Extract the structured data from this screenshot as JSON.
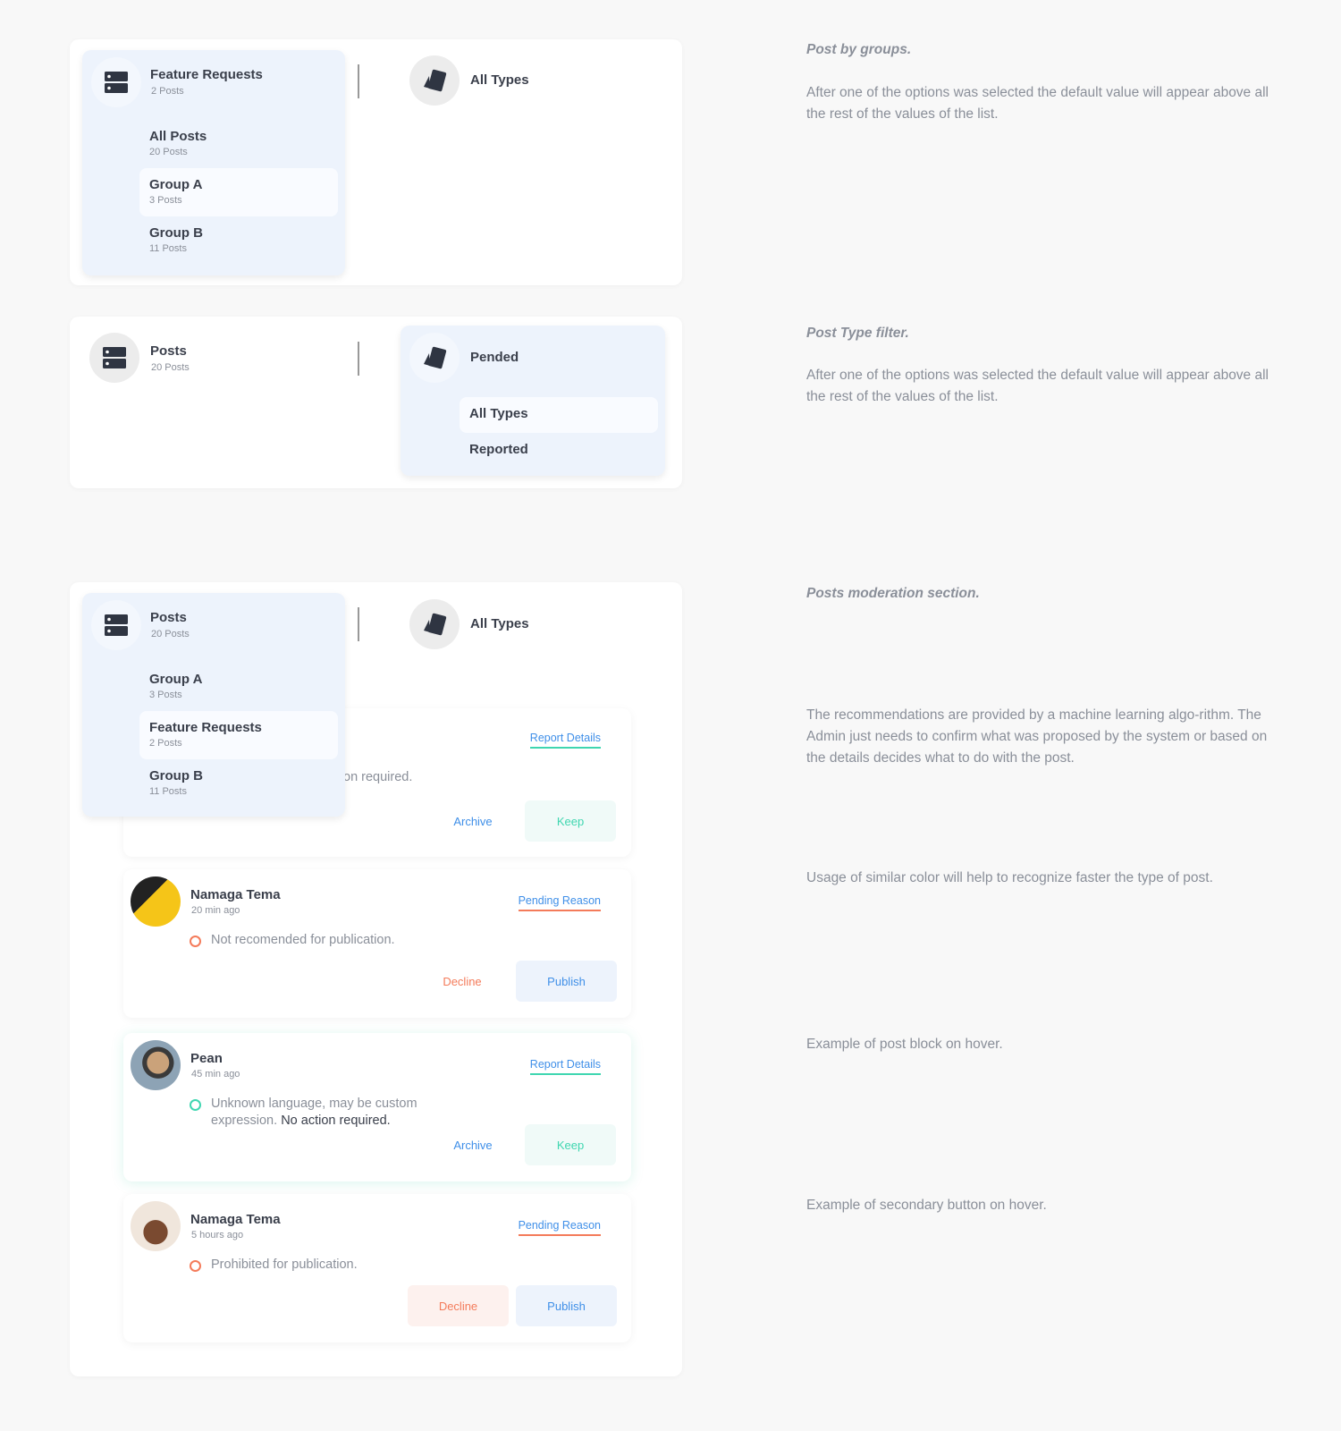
{
  "section1": {
    "group_title": "Feature Requests",
    "group_sub": "2 Posts",
    "items": [
      {
        "label": "All Posts",
        "count": "20 Posts"
      },
      {
        "label": "Group A",
        "count": "3 Posts"
      },
      {
        "label": "Group B",
        "count": "11 Posts"
      }
    ],
    "type_label": "All Types"
  },
  "section2": {
    "group_title": "Posts",
    "group_sub": "20 Posts",
    "type_label": "Pended",
    "types": [
      "All Types",
      "Reported"
    ]
  },
  "section3": {
    "group_title": "Posts",
    "group_sub": "20 Posts",
    "items": [
      {
        "label": "Group A",
        "count": "3 Posts"
      },
      {
        "label": "Feature Requests",
        "count": "2 Posts"
      },
      {
        "label": "Group B",
        "count": "11 Posts"
      }
    ],
    "type_label": "All Types",
    "posts": [
      {
        "link": "Report Details",
        "message_partial": "on required.",
        "secondary": "Archive",
        "primary": "Keep"
      },
      {
        "name": "Namaga Tema",
        "time": "20 min ago",
        "link": "Pending Reason",
        "message": "Not recomended for publication.",
        "secondary": "Decline",
        "primary": "Publish"
      },
      {
        "name": "Pean",
        "time": "45 min ago",
        "link": "Report Details",
        "message": "Unknown language, may be custom expression.",
        "message_strong": "No action required.",
        "secondary": "Archive",
        "primary": "Keep"
      },
      {
        "name": "Namaga Tema",
        "time": "5 hours ago",
        "link": "Pending Reason",
        "message": "Prohibited for publication.",
        "secondary": "Decline",
        "primary": "Publish"
      }
    ]
  },
  "notes": {
    "n1_title": "Post by groups.",
    "n1_body": "After one of the options was selected the default value will appear above all the rest of the values of the list.",
    "n2_title": "Post Type filter.",
    "n2_body": "After one of the options was selected the default value will appear above all the rest of the values of the list.",
    "n3_title": "Posts moderation section.",
    "n4": "The recommendations are provided by a machine learning algo-rithm. The Admin just needs to confirm what was proposed by the system or based on the details decides what to do with the post.",
    "n5": "Usage of similar color will help to recognize faster the type of post.",
    "n6": "Example of post block on hover.",
    "n7": "Example of secondary button on hover."
  },
  "colors": {
    "accent_blue": "#3f8fe8",
    "green": "#3fd6b0",
    "orange": "#f47b5a",
    "dropdown_bg": "#edf3fc"
  },
  "icons": {
    "group": "server-icon",
    "type": "cards-icon"
  }
}
